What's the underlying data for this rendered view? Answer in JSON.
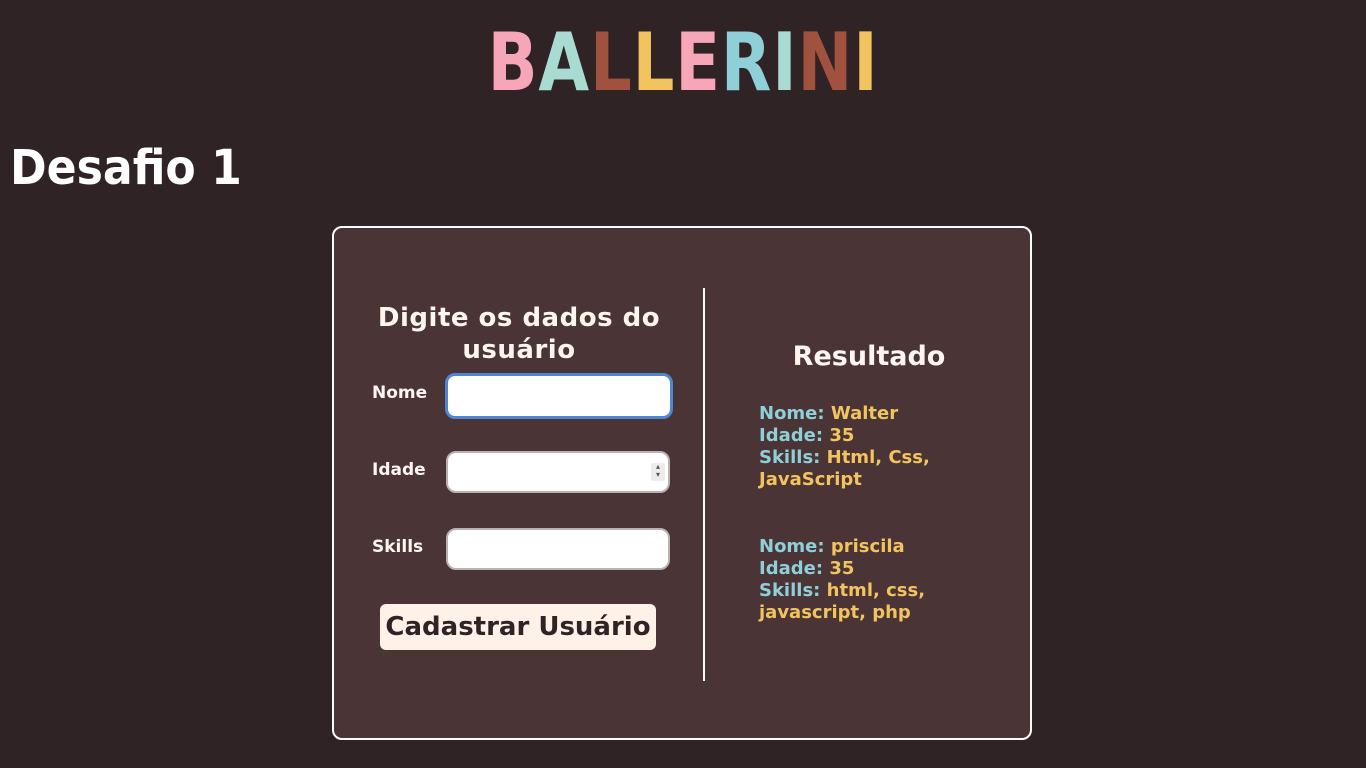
{
  "logo": {
    "letters": [
      "B",
      "A",
      "L",
      "L",
      "E",
      "R",
      "I",
      "N",
      "I"
    ],
    "colors": [
      "#f7a6b8",
      "#a8dcd3",
      "#a0523f",
      "#f1c45f",
      "#f7a6b8",
      "#8fd0d8",
      "#a8dcd3",
      "#a0523f",
      "#f1c45f"
    ]
  },
  "page_title": "Desafio 1",
  "form": {
    "heading": "Digite os dados do usuário",
    "fields": [
      {
        "label": "Nome",
        "value": ""
      },
      {
        "label": "Idade",
        "value": ""
      },
      {
        "label": "Skills",
        "value": ""
      }
    ],
    "submit_label": "Cadastrar Usuário"
  },
  "results": {
    "heading": "Resultado",
    "labels": {
      "name": "Nome:",
      "age": "Idade:",
      "skills": "Skills:"
    },
    "entries": [
      {
        "name": "Walter",
        "age": "35",
        "skills": "Html, Css, JavaScript"
      },
      {
        "name": "priscila",
        "age": "35",
        "skills": "html, css, javascript, php"
      }
    ]
  },
  "colors": {
    "background": "#2f2325",
    "card": "#4a3436",
    "key": "#8fd0d8",
    "value": "#f1c45f",
    "focus": "#4f86d1"
  }
}
